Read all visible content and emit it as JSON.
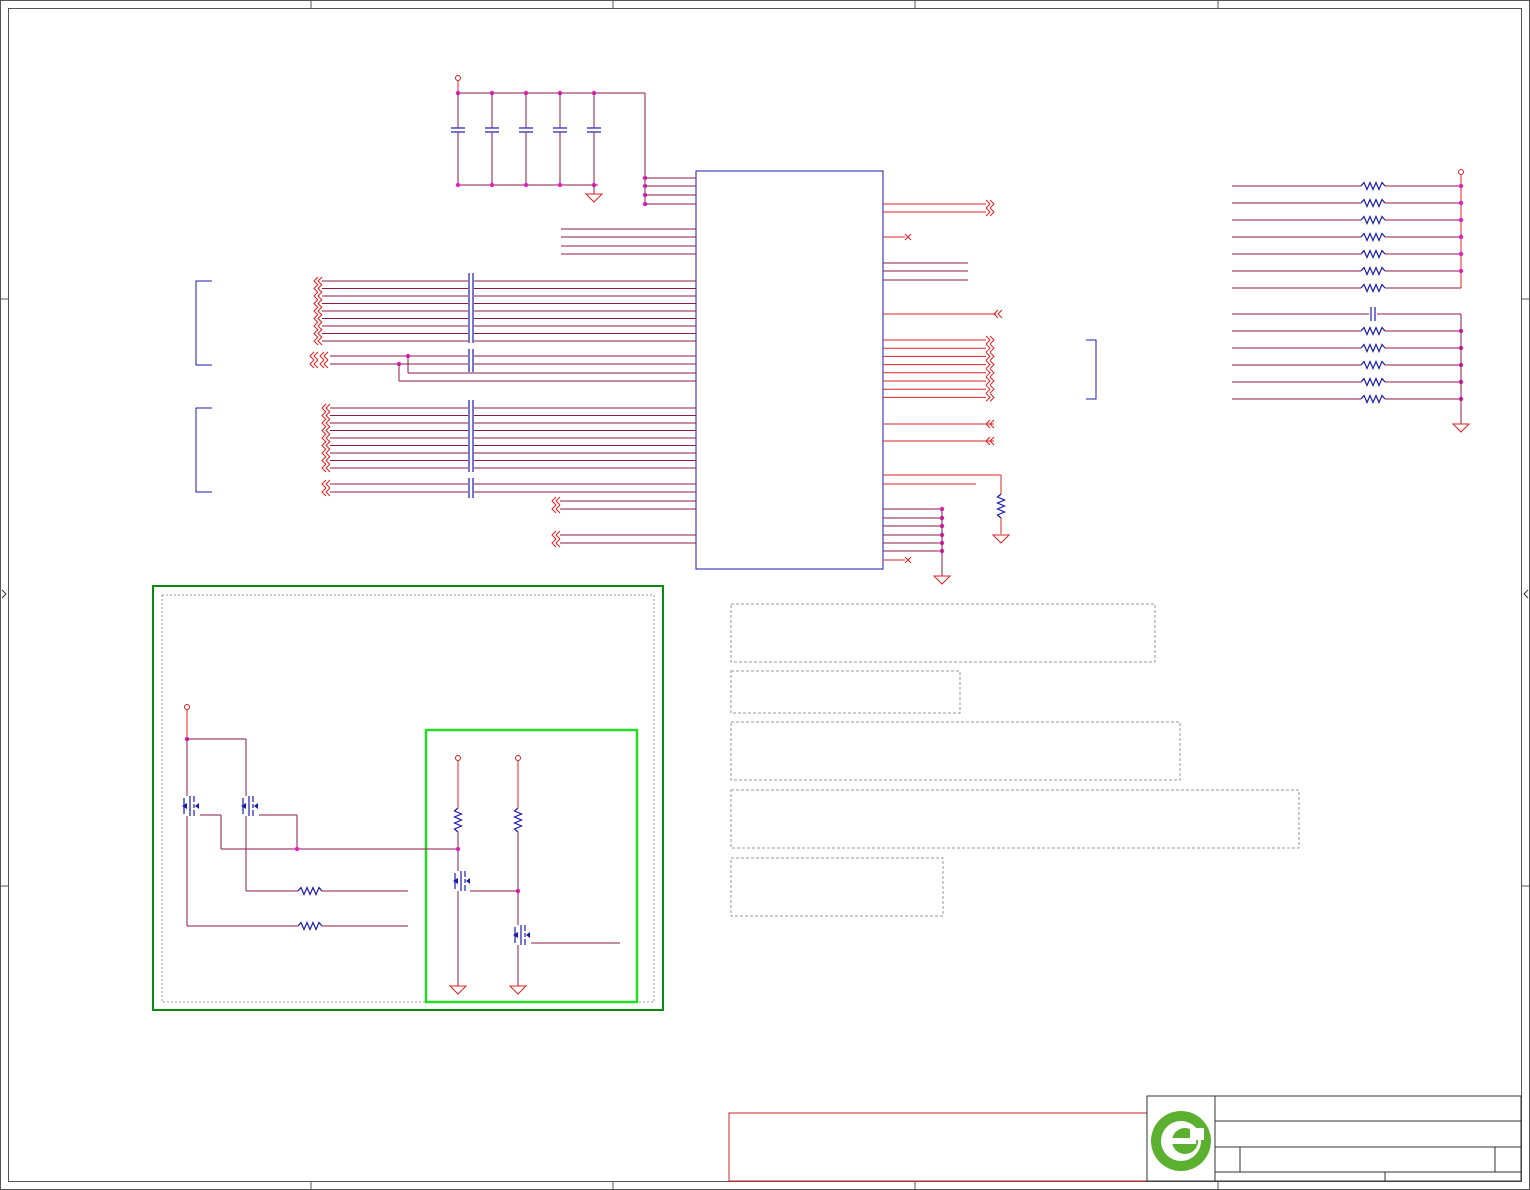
{
  "sheet": {
    "title": "",
    "zone_markers": {
      "columns": [],
      "rows": []
    }
  },
  "colors": {
    "wire": "#8b1a4a",
    "net_port": "#e02020",
    "component": "#1a1ab0",
    "junction": "#e020c0",
    "group_outer": "#0a8a0a",
    "group_inner": "#22dd22",
    "revision_box": "#cc2222",
    "logo": "#5cb030"
  },
  "title_block": {
    "logo": "logo-mark",
    "company": "",
    "title": "",
    "size": "",
    "rev": ""
  },
  "notes": [],
  "icons": [
    "power-symbol",
    "ground-symbol",
    "resistor",
    "capacitor",
    "mosfet",
    "net-port-arrow",
    "no-connect",
    "logo-mark"
  ]
}
